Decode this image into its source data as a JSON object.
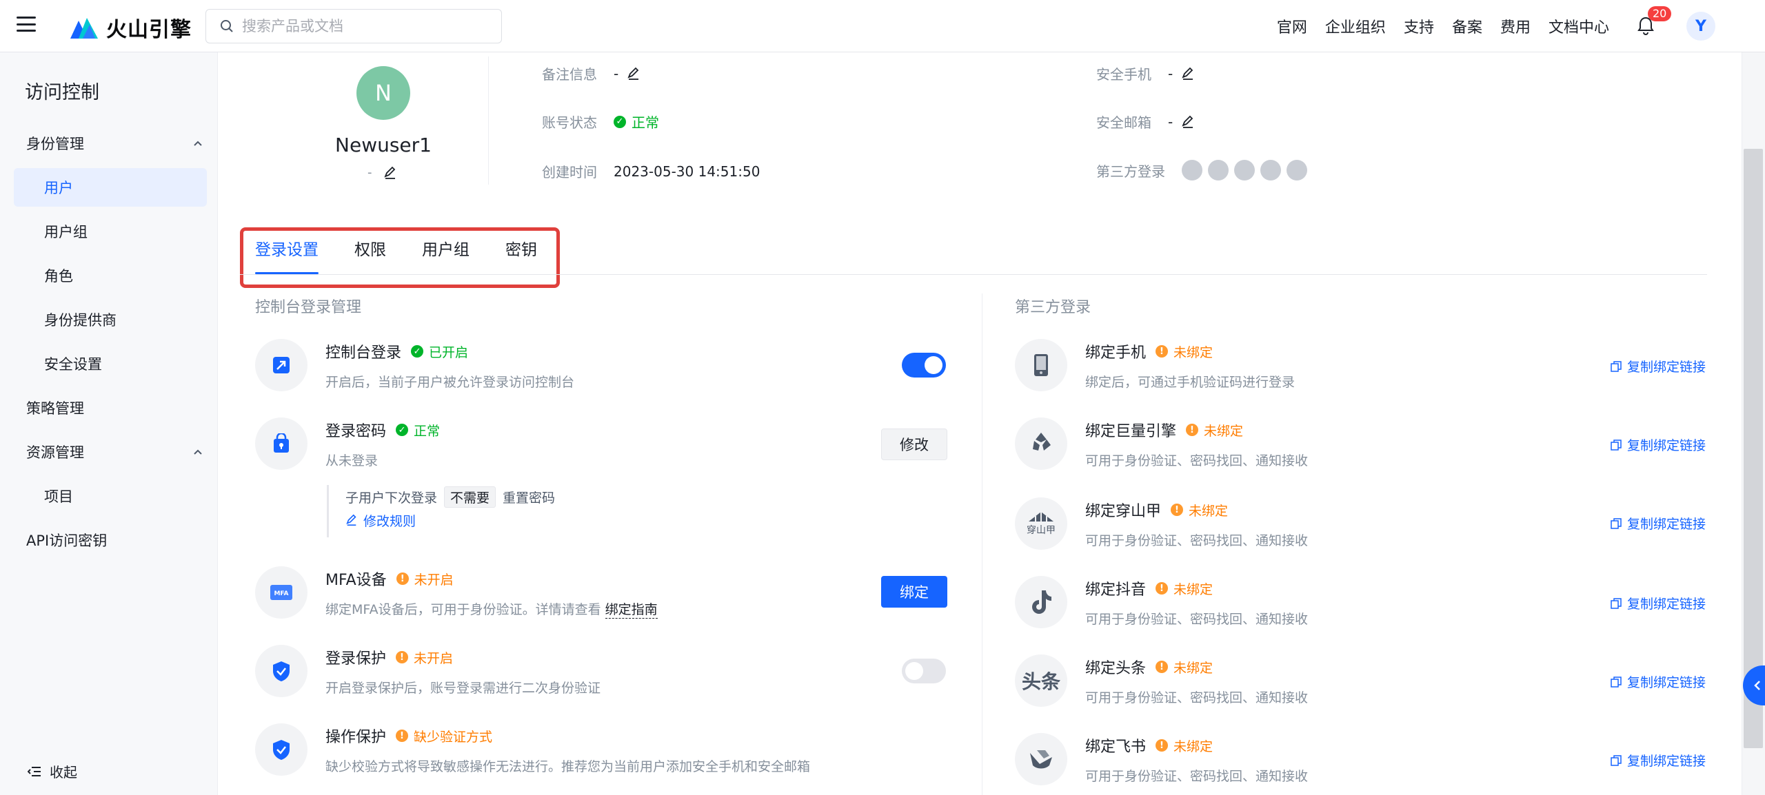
{
  "topbar": {
    "brand": "火山引擎",
    "search_placeholder": "搜索产品或文档",
    "nav": [
      "官网",
      "企业组织",
      "支持",
      "备案",
      "费用",
      "文档中心"
    ],
    "notification_count": "20",
    "user_initial": "Y"
  },
  "sidebar": {
    "title": "访问控制",
    "groups": {
      "identity": "身份管理",
      "users": "用户",
      "user_groups": "用户组",
      "roles": "角色",
      "idp": "身份提供商",
      "security": "安全设置",
      "policy": "策略管理",
      "resource": "资源管理",
      "project": "项目",
      "api_keys": "API访问密钥"
    },
    "collapse_label": "收起"
  },
  "profile": {
    "initial": "N",
    "name": "Newuser1",
    "note": "-"
  },
  "info": {
    "remark_label": "备注信息",
    "remark_value": "-",
    "status_label": "账号状态",
    "status_value": "正常",
    "created_label": "创建时间",
    "created_value": "2023-05-30 14:51:50",
    "phone_label": "安全手机",
    "phone_value": "-",
    "email_label": "安全邮箱",
    "email_value": "-",
    "third_label": "第三方登录"
  },
  "tabs": [
    "登录设置",
    "权限",
    "用户组",
    "密钥"
  ],
  "console": {
    "section_title": "控制台登录管理",
    "console_login": {
      "title": "控制台登录",
      "status": "已开启",
      "desc": "开启后，当前子用户被允许登录访问控制台"
    },
    "password": {
      "title": "登录密码",
      "status": "正常",
      "desc": "从未登录",
      "button": "修改",
      "next_login_label": "子用户下次登录",
      "next_login_tag": "不需要",
      "reset_label": "重置密码",
      "rule_link": "修改规则"
    },
    "mfa": {
      "title": "MFA设备",
      "status": "未开启",
      "desc": "绑定MFA设备后，可用于身份验证。详情请查看",
      "guide": "绑定指南",
      "button": "绑定",
      "icon_text": "MFA"
    },
    "login_protect": {
      "title": "登录保护",
      "status": "未开启",
      "desc": "开启登录保护后，账号登录需进行二次身份验证"
    },
    "op_protect": {
      "title": "操作保护",
      "status": "缺少验证方式",
      "desc": "缺少校验方式将导致敏感操作无法进行。推荐您为当前用户添加安全手机和安全邮箱"
    }
  },
  "third": {
    "section_title": "第三方登录",
    "copy_label": "复制绑定链接",
    "items": [
      {
        "title": "绑定手机",
        "status": "未绑定",
        "desc": "绑定后，可通过手机验证码进行登录"
      },
      {
        "title": "绑定巨量引擎",
        "status": "未绑定",
        "desc": "可用于身份验证、密码找回、通知接收"
      },
      {
        "title": "绑定穿山甲",
        "status": "未绑定",
        "desc": "可用于身份验证、密码找回、通知接收",
        "icon_text": "穿山甲"
      },
      {
        "title": "绑定抖音",
        "status": "未绑定",
        "desc": "可用于身份验证、密码找回、通知接收"
      },
      {
        "title": "绑定头条",
        "status": "未绑定",
        "desc": "可用于身份验证、密码找回、通知接收",
        "icon_text": "头条"
      },
      {
        "title": "绑定飞书",
        "status": "未绑定",
        "desc": "可用于身份验证、密码找回、通知接收"
      }
    ]
  },
  "colors": {
    "primary": "#1664ff",
    "success": "#00b42a",
    "warning": "#ff7d00",
    "highlight": "#e0403c"
  }
}
